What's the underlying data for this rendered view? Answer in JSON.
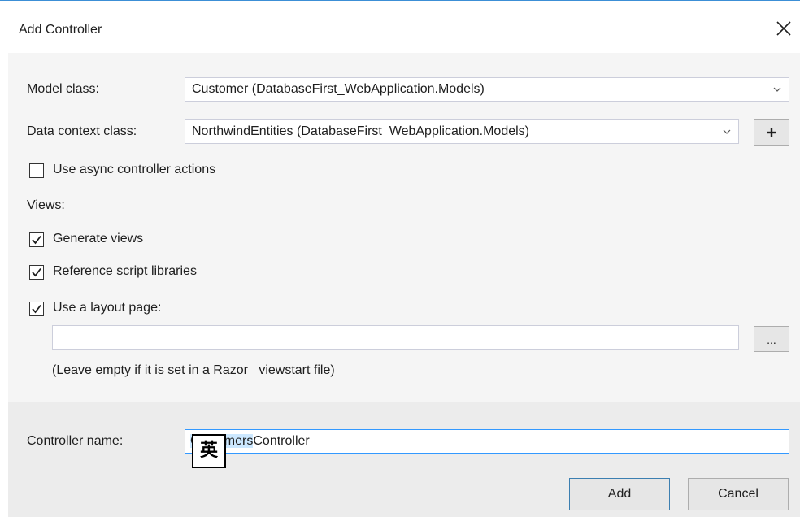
{
  "dialog": {
    "title": "Add Controller",
    "close_icon": "close-icon"
  },
  "model_class": {
    "label": "Model class:",
    "value": "Customer (DatabaseFirst_WebApplication.Models)"
  },
  "data_context_class": {
    "label": "Data context class:",
    "value": "NorthwindEntities (DatabaseFirst_WebApplication.Models)",
    "add_button_label": "+"
  },
  "options": {
    "async": {
      "label": "Use async controller actions",
      "checked": false
    }
  },
  "views": {
    "heading": "Views:",
    "generate_views": {
      "label": "Generate views",
      "checked": true
    },
    "reference_scripts": {
      "label": "Reference script libraries",
      "checked": true
    },
    "use_layout": {
      "label": "Use a layout page:",
      "checked": true
    },
    "layout_path": "",
    "browse_button_label": "...",
    "hint": "(Leave empty if it is set in a Razor _viewstart file)"
  },
  "controller": {
    "label": "Controller name:",
    "name_selected": "Customers",
    "name_rest": "Controller"
  },
  "ime": {
    "indicator": "英"
  },
  "buttons": {
    "add": "Add",
    "cancel": "Cancel"
  },
  "colors": {
    "accent": "#3399ff",
    "selection": "#cce8ff",
    "title_border": "#3c8fd6"
  }
}
